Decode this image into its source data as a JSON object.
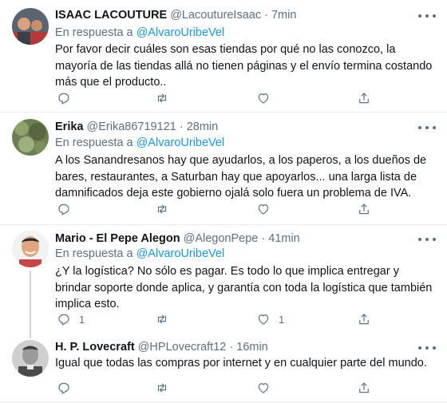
{
  "tweets": [
    {
      "name": "ISAAC LACOUTURE",
      "handle": "@LacoutureIsaac",
      "dot": "·",
      "time": "7min",
      "reply_prefix": "En respuesta a",
      "reply_to": "@AlvaroUribeVel",
      "text": "Por favor decir cuáles son esas tiendas por qué no las conozco, la mayoría de las tiendas allá no tienen páginas y el envío termina costando más que el producto..",
      "reply_count": "",
      "like_count": ""
    },
    {
      "name": "Erika",
      "handle": "@Erika86719121",
      "dot": "·",
      "time": "28min",
      "reply_prefix": "En respuesta a",
      "reply_to": "@AlvaroUribeVel",
      "text": "A los Sanandresanos hay que ayudarlos, a los paperos, a los dueños de bares, restaurantes, a Saturban hay que apoyarlos... una larga lista de damnificados deja este gobierno ojalá solo fuera un problema de IVA.",
      "reply_count": "",
      "like_count": ""
    },
    {
      "name": "Mario - El Pepe Alegon",
      "handle": "@AlegonPepe",
      "dot": "·",
      "time": "41min",
      "reply_prefix": "En respuesta a",
      "reply_to": "@AlvaroUribeVel",
      "text": "¿Y la logística? No sólo es pagar. Es todo lo que implica entregar y brindar soporte donde aplica, y garantía con toda la logística que también implica esto.",
      "reply_count": "1",
      "like_count": "1"
    },
    {
      "name": "H. P. Lovecraft",
      "handle": "@HPLovecraft12",
      "dot": "·",
      "time": "16min",
      "text": "Igual que todas las compras por internet y en cualquier parte del mundo.",
      "reply_count": "",
      "like_count": ""
    }
  ],
  "colors": {
    "text": "#0f1419",
    "muted": "#5b7083",
    "link": "#1b95e0",
    "divider": "#e6ecf0",
    "thread": "#ccd6dd"
  }
}
